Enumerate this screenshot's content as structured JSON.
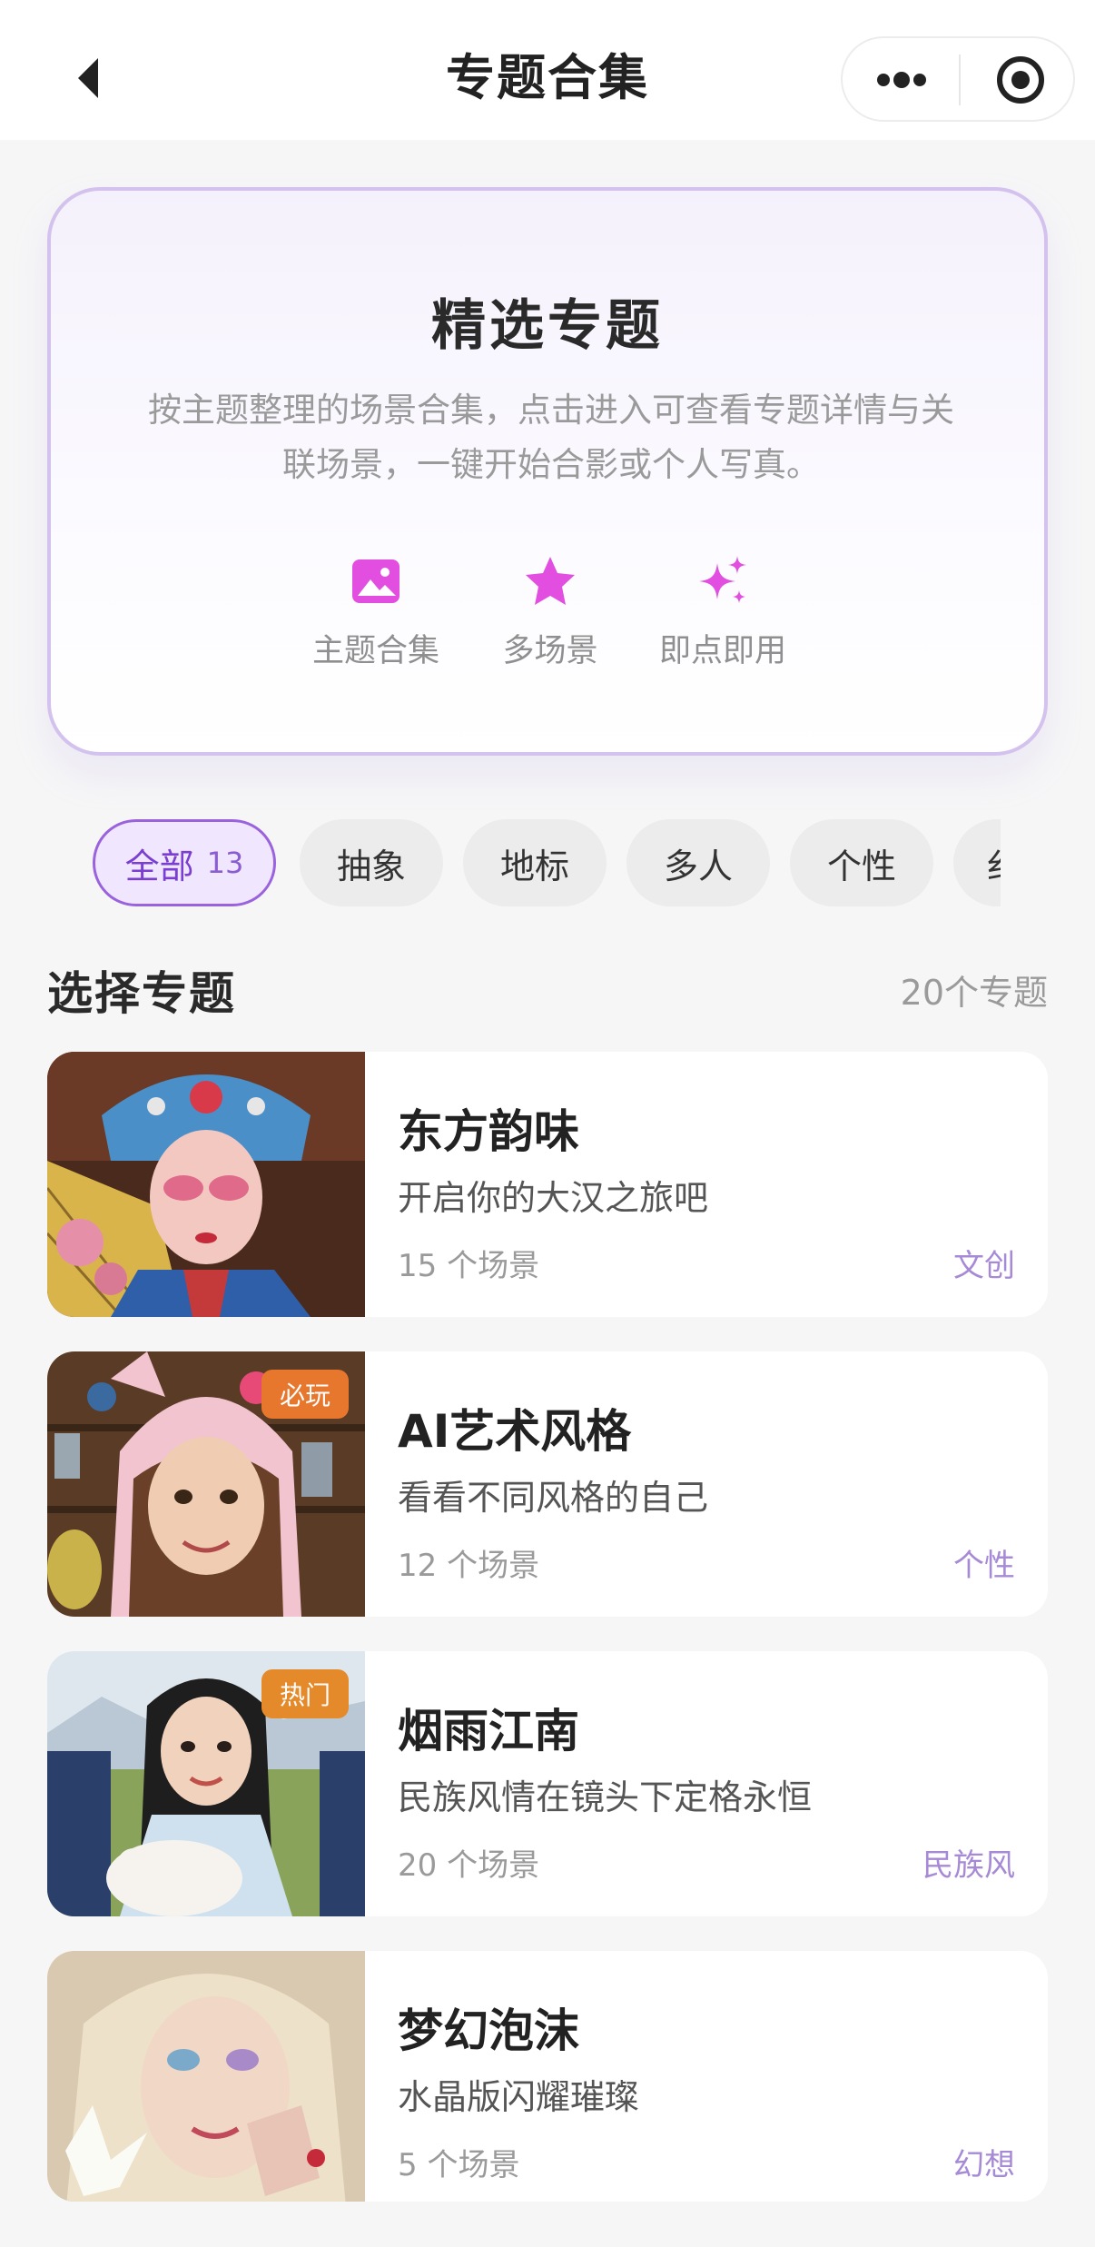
{
  "nav": {
    "title": "专题合集"
  },
  "hero": {
    "title": "精选专题",
    "description": "按主题整理的场景合集，点击进入可查看专题详情与关联场景，一键开始合影或个人写真。",
    "features": [
      {
        "label": "主题合集",
        "icon": "image-icon"
      },
      {
        "label": "多场景",
        "icon": "star-icon"
      },
      {
        "label": "即点即用",
        "icon": "sparkle-icon"
      }
    ],
    "accent_color": "#e24fe0"
  },
  "filters": [
    {
      "label": "全部",
      "count": "13",
      "active": true
    },
    {
      "label": "抽象"
    },
    {
      "label": "地标"
    },
    {
      "label": "多人"
    },
    {
      "label": "个性"
    },
    {
      "label": "纟"
    }
  ],
  "section": {
    "title": "选择专题",
    "count": "20个专题"
  },
  "topics": [
    {
      "title": "东方韵味",
      "subtitle": "开启你的大汉之旅吧",
      "count": "15 个场景",
      "tag": "文创",
      "badge": ""
    },
    {
      "title": "AI艺术风格",
      "subtitle": "看看不同风格的自己",
      "count": "12 个场景",
      "tag": "个性",
      "badge": "必玩"
    },
    {
      "title": "烟雨江南",
      "subtitle": "民族风情在镜头下定格永恒",
      "count": "20 个场景",
      "tag": "民族风",
      "badge": "热门"
    },
    {
      "title": "梦幻泡沫",
      "subtitle": "水晶版闪耀璀璨",
      "count": "5 个场景",
      "tag": "幻想",
      "badge": ""
    }
  ],
  "colors": {
    "chip_active_border": "#9a62dd",
    "tag": "#a68ad6",
    "badge_must": "#e8772e",
    "badge_hot": "#e58a2a"
  }
}
